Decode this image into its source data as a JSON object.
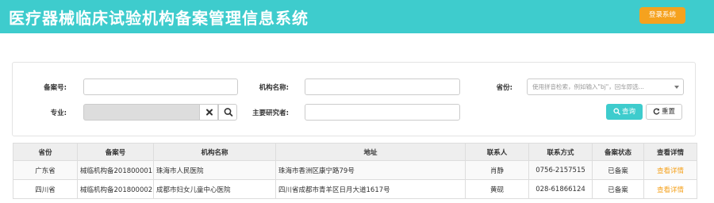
{
  "header": {
    "title": "医疗器械临床试验机构备案管理信息系统",
    "login_label": "登录系统",
    "colors": {
      "bar": "#3ecccd",
      "login": "#f5a21e"
    }
  },
  "search": {
    "record_no_label": "备案号:",
    "record_no_value": "",
    "org_name_label": "机构名称:",
    "org_name_value": "",
    "province_label": "省份:",
    "province_placeholder": "使用拼音检索，例如输入\"bj\"，回车即选...",
    "specialty_label": "专业:",
    "specialty_value": "",
    "researcher_label": "主要研究者:",
    "researcher_value": "",
    "query_label": "查询",
    "reset_label": "重置",
    "icons": {
      "clear": "close-icon",
      "search": "search-icon",
      "query": "search-icon",
      "reset": "refresh-icon"
    }
  },
  "table": {
    "headers": [
      "省份",
      "备案号",
      "机构名称",
      "地址",
      "联系人",
      "联系方式",
      "备案状态",
      "查看详情"
    ],
    "rows": [
      [
        "广东省",
        "械临机构备201800001",
        "珠海市人民医院",
        "珠海市香洲区康宁路79号",
        "肖静",
        "0756-2157515",
        "已备案",
        "查看详情"
      ],
      [
        "四川省",
        "械临机构备201800002",
        "成都市妇女儿童中心医院",
        "四川省成都市青羊区日月大道1617号",
        "黄砚",
        "028-61866124",
        "已备案",
        "查看详情"
      ]
    ],
    "link_color": "#f5a21e"
  }
}
